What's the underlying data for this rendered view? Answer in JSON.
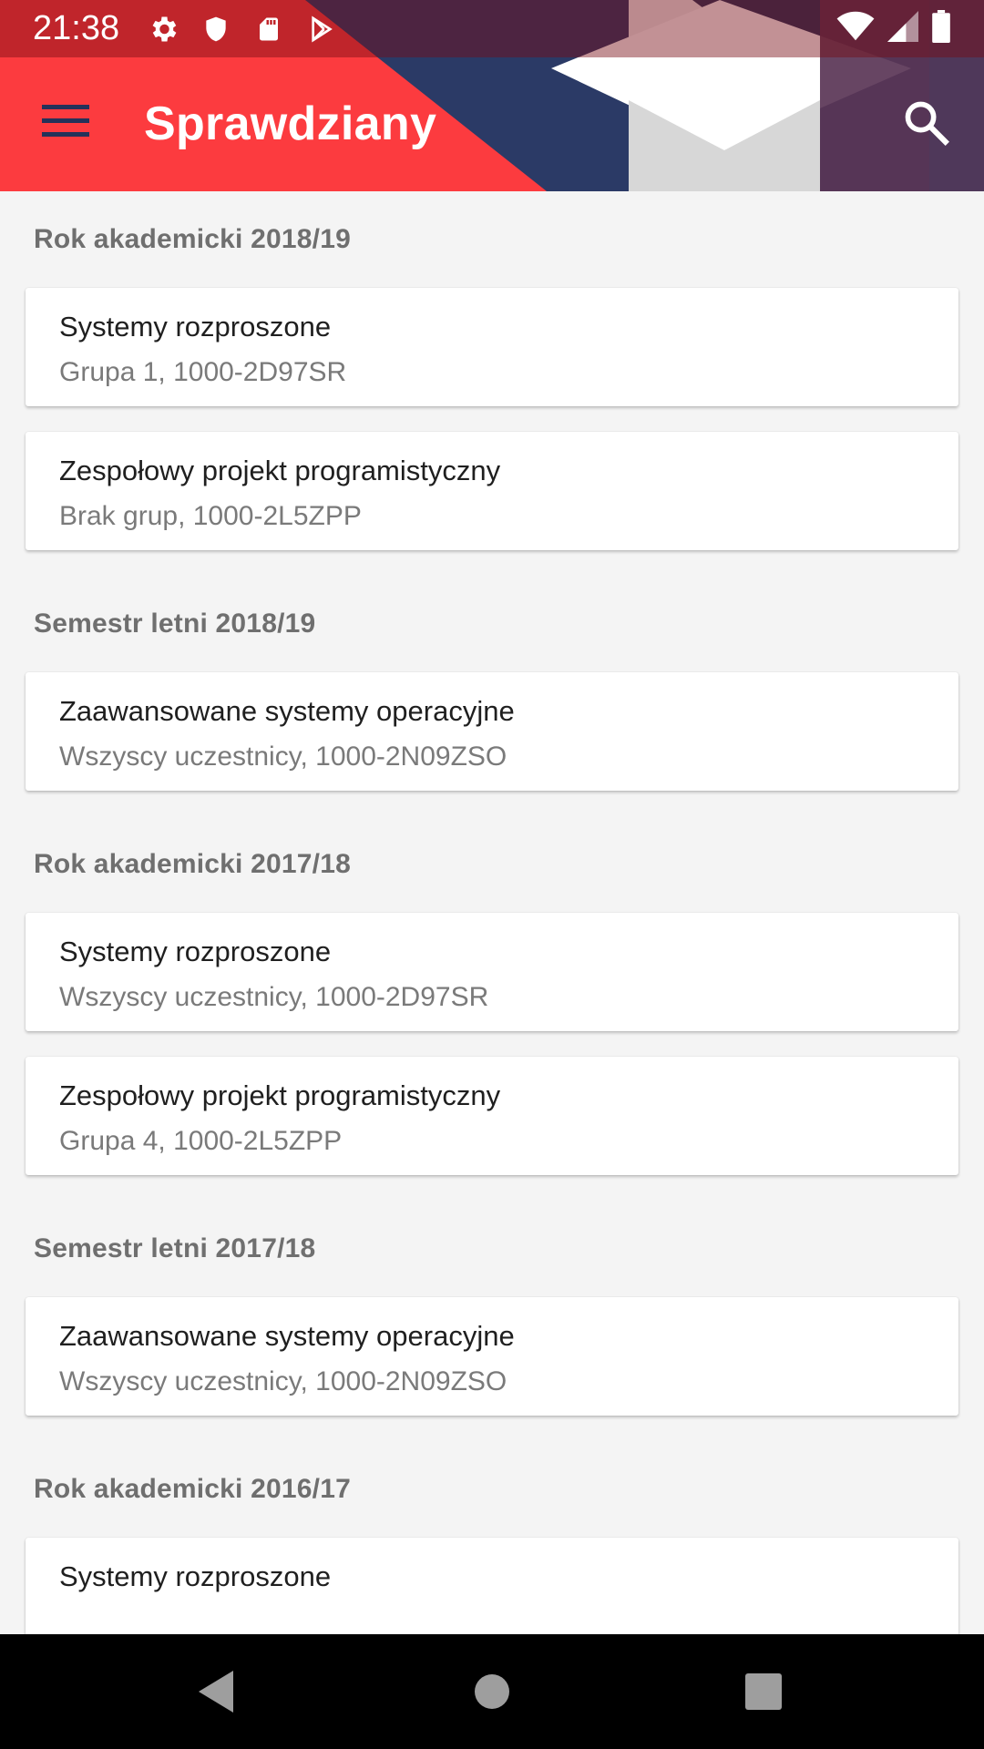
{
  "status_bar": {
    "time": "21:38",
    "icons_left": [
      "settings-icon",
      "shield-icon",
      "sd-card-icon",
      "play-store-icon"
    ],
    "icons_right": [
      "wifi-icon",
      "signal-icon",
      "battery-icon"
    ]
  },
  "app_bar": {
    "title": "Sprawdziany",
    "menu_icon": "hamburger-menu-icon",
    "search_icon": "search-icon"
  },
  "sections": [
    {
      "header": "Rok akademicki 2018/19",
      "items": [
        {
          "title": "Systemy rozproszone",
          "subtitle": "Grupa 1, 1000-2D97SR"
        },
        {
          "title": "Zespołowy projekt programistyczny",
          "subtitle": "Brak grup, 1000-2L5ZPP"
        }
      ]
    },
    {
      "header": "Semestr letni 2018/19",
      "items": [
        {
          "title": "Zaawansowane systemy operacyjne",
          "subtitle": "Wszyscy uczestnicy, 1000-2N09ZSO"
        }
      ]
    },
    {
      "header": "Rok akademicki 2017/18",
      "items": [
        {
          "title": "Systemy rozproszone",
          "subtitle": "Wszyscy uczestnicy, 1000-2D97SR"
        },
        {
          "title": "Zespołowy projekt programistyczny",
          "subtitle": "Grupa 4, 1000-2L5ZPP"
        }
      ]
    },
    {
      "header": "Semestr letni 2017/18",
      "items": [
        {
          "title": "Zaawansowane systemy operacyjne",
          "subtitle": "Wszyscy uczestnicy, 1000-2N09ZSO"
        }
      ]
    },
    {
      "header": "Rok akademicki 2016/17",
      "items": [
        {
          "title": "Systemy rozproszone",
          "subtitle": ""
        }
      ]
    }
  ],
  "nav_bar": {
    "back_icon": "back-triangle-icon",
    "home_icon": "home-circle-icon",
    "recents_icon": "recents-square-icon"
  },
  "colors": {
    "primary": "#fc3b3f",
    "status_bar_overlay": "#8c1a1f",
    "background": "#f4f4f4",
    "section_header_text": "#6f6f6f",
    "card_subtitle_text": "#7a7a7a"
  }
}
